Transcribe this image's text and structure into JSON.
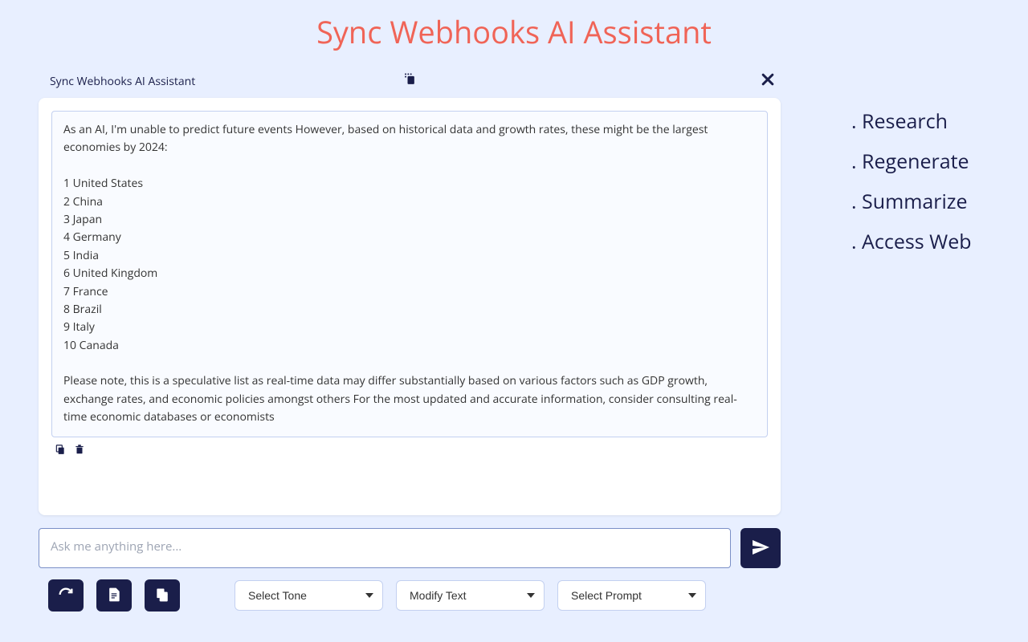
{
  "page_title": "Sync Webhooks AI Assistant",
  "chat": {
    "header_title": "Sync Webhooks AI Assistant",
    "message": "As an AI, I'm unable to predict future events However, based on historical data and growth rates, these might be the largest economies by 2024:\n\n1 United States\n2 China\n3 Japan\n4 Germany\n5 India\n6 United Kingdom\n7 France\n8 Brazil\n9 Italy\n10 Canada\n\nPlease note, this is a speculative list as real-time data may differ substantially based on various factors such as GDP growth, exchange rates, and economic policies amongst others For the most updated and accurate information, consider consulting real-time economic databases or economists"
  },
  "input": {
    "placeholder": "Ask me anything here..."
  },
  "selects": {
    "tone": "Select Tone",
    "modify": "Modify Text",
    "prompt": "Select Prompt"
  },
  "sidebar": {
    "items": [
      ". Research",
      ". Regenerate",
      ". Summarize",
      ". Access Web"
    ]
  }
}
